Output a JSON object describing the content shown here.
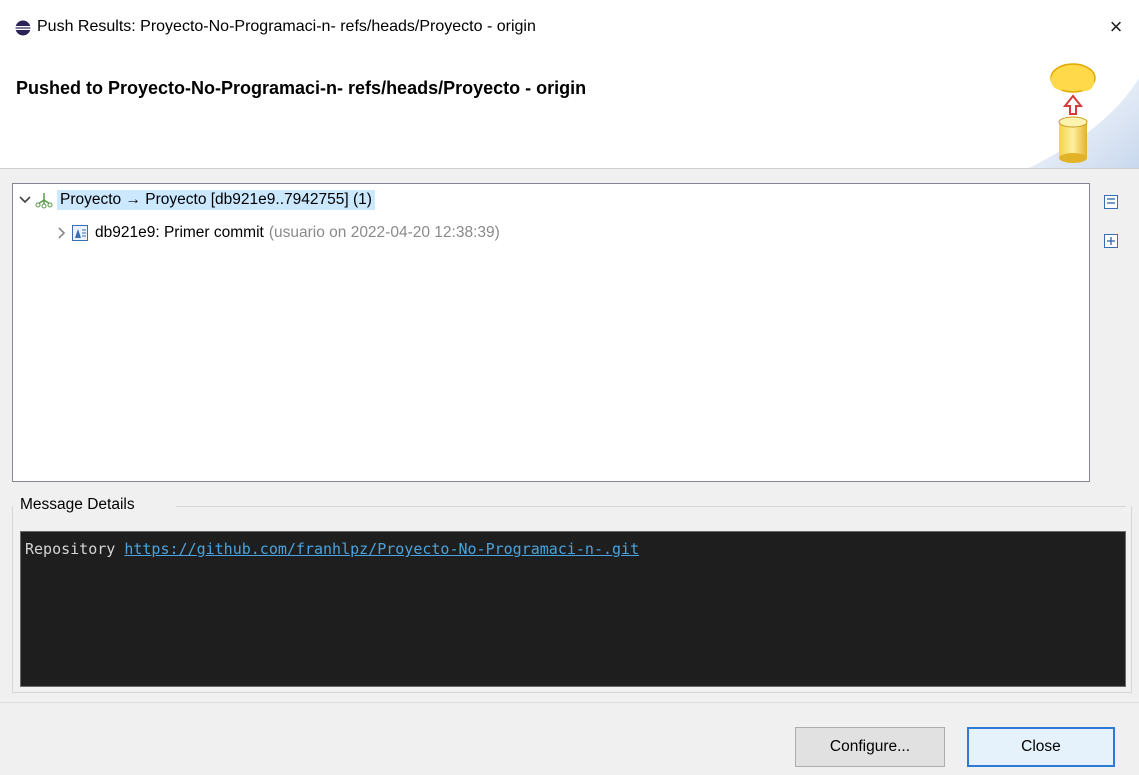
{
  "window": {
    "title": "Push Results: Proyecto-No-Programaci-n- refs/heads/Proyecto - origin",
    "close_glyph": "×"
  },
  "banner": {
    "heading": "Pushed to Proyecto-No-Programaci-n- refs/heads/Proyecto - origin",
    "image_icon": "cloud-push-database-icon"
  },
  "tree": {
    "items": [
      {
        "label": "Proyecto → Proyecto [db921e9..7942755] (1)",
        "expanded": true,
        "icon": "branch-icon",
        "selected": true
      },
      {
        "label": "db921e9: Primer commit",
        "meta": "(usuario on 2022-04-20 12:38:39)",
        "expanded": false,
        "icon": "commit-icon"
      }
    ],
    "toolbar": [
      "collapse-all-icon",
      "expand-all-icon"
    ]
  },
  "message_details": {
    "label": "Message Details",
    "prefix": "Repository ",
    "link": "https://github.com/franhlpz/Proyecto-No-Programaci-n-.git"
  },
  "buttons": {
    "configure": "Configure...",
    "close": "Close"
  },
  "colors": {
    "selection": "#cce8ff",
    "console_bg": "#1e1e1e",
    "link": "#4aa3df",
    "default_button_border": "#2a7bd6"
  }
}
